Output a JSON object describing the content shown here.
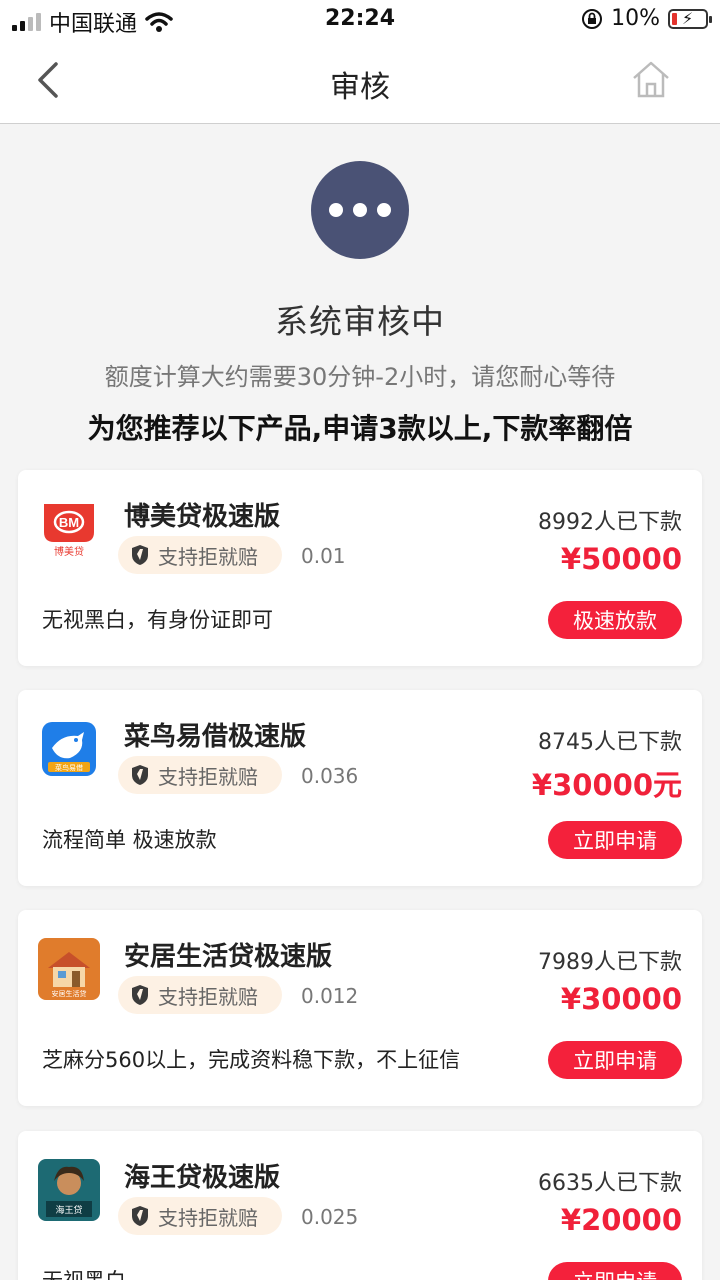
{
  "status_bar": {
    "carrier": "中国联通",
    "time": "22:24",
    "battery_percent": "10%",
    "icons": [
      "signal-icon",
      "wifi-icon",
      "orientation-lock-icon",
      "battery-charging-icon"
    ]
  },
  "nav": {
    "title": "审核",
    "icons": [
      "back-chevron-icon",
      "home-icon"
    ]
  },
  "hero": {
    "title": "系统审核中",
    "subtitle": "额度计算大约需要30分钟-2小时，请您耐心等待",
    "promo": "为您推荐以下产品,申请3款以上,下款率翻倍"
  },
  "colors": {
    "accent_red": "#f4213b",
    "status_circle": "#4a5275",
    "tag_bg": "#fdf1e4"
  },
  "products": [
    {
      "name": "博美贷极速版",
      "tag": "支持拒就赔",
      "rate": "0.01",
      "count": "8992人已下款",
      "amount": "¥50000",
      "desc": "无视黑白，有身份证即可",
      "cta": "极速放款",
      "logo_text": "博美贷"
    },
    {
      "name": "菜鸟易借极速版",
      "tag": "支持拒就赔",
      "rate": "0.036",
      "count": "8745人已下款",
      "amount": "¥30000元",
      "desc": "流程简单 极速放款",
      "cta": "立即申请",
      "logo_text": "菜鸟易借"
    },
    {
      "name": "安居生活贷极速版",
      "tag": "支持拒就赔",
      "rate": "0.012",
      "count": "7989人已下款",
      "amount": "¥30000",
      "desc": "芝麻分560以上，完成资料稳下款，不上征信",
      "cta": "立即申请",
      "logo_text": "安居生活贷"
    },
    {
      "name": "海王贷极速版",
      "tag": "支持拒就赔",
      "rate": "0.025",
      "count": "6635人已下款",
      "amount": "¥20000",
      "desc": "无视黑白",
      "cta": "立即申请",
      "logo_text": "海王贷"
    }
  ]
}
